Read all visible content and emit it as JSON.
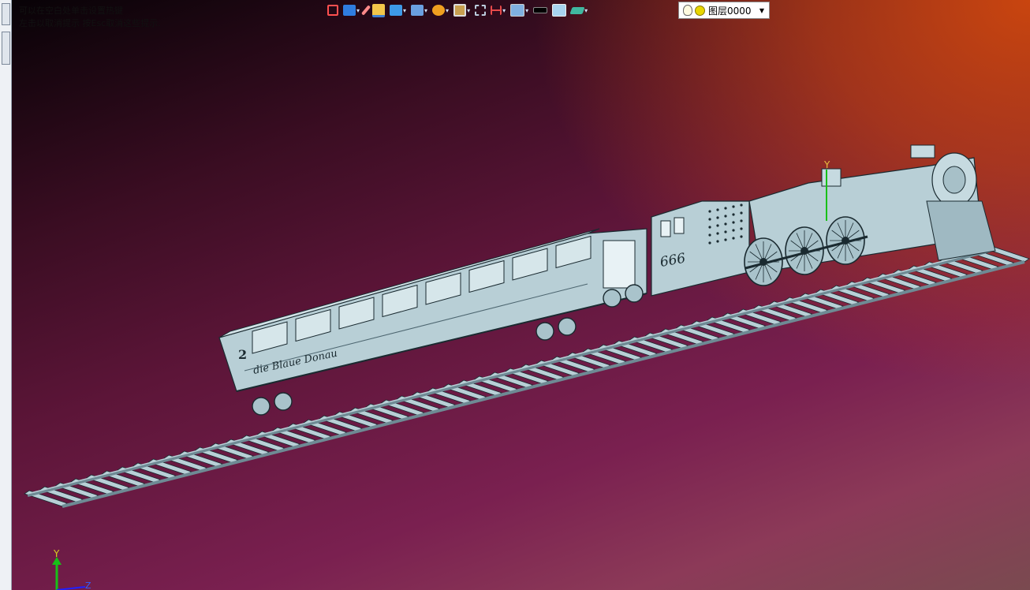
{
  "hints": {
    "line1": "可以在空白处单击设置热键",
    "line2": "左击以取消提示 按Esc取消这些提示."
  },
  "toolbar": {
    "items": [
      "exit-icon",
      "view-icon",
      "pen-icon",
      "layer-stack-icon",
      "cube-icon",
      "render-icon",
      "sphere-icon",
      "zoom-icon",
      "fit-icon",
      "dimension-icon",
      "display-icon",
      "line-color-icon",
      "fill-color-icon",
      "workplane-icon"
    ],
    "layer_name": "图层0000"
  },
  "colors": {
    "model": "#b8cfd6",
    "model_dark": "#6e8a94",
    "model_edge": "#1a2a30",
    "axis_x": "#ff2020",
    "axis_y": "#18c018",
    "axis_z": "#2020ff",
    "layer_bulb": "#e8d600"
  },
  "model": {
    "locomotive_number": "666",
    "car_number": "2",
    "car_script": "die Blaue Donau"
  },
  "axes": {
    "y_label": "Y",
    "z_label": "Z",
    "triad_y_label": "Y"
  }
}
